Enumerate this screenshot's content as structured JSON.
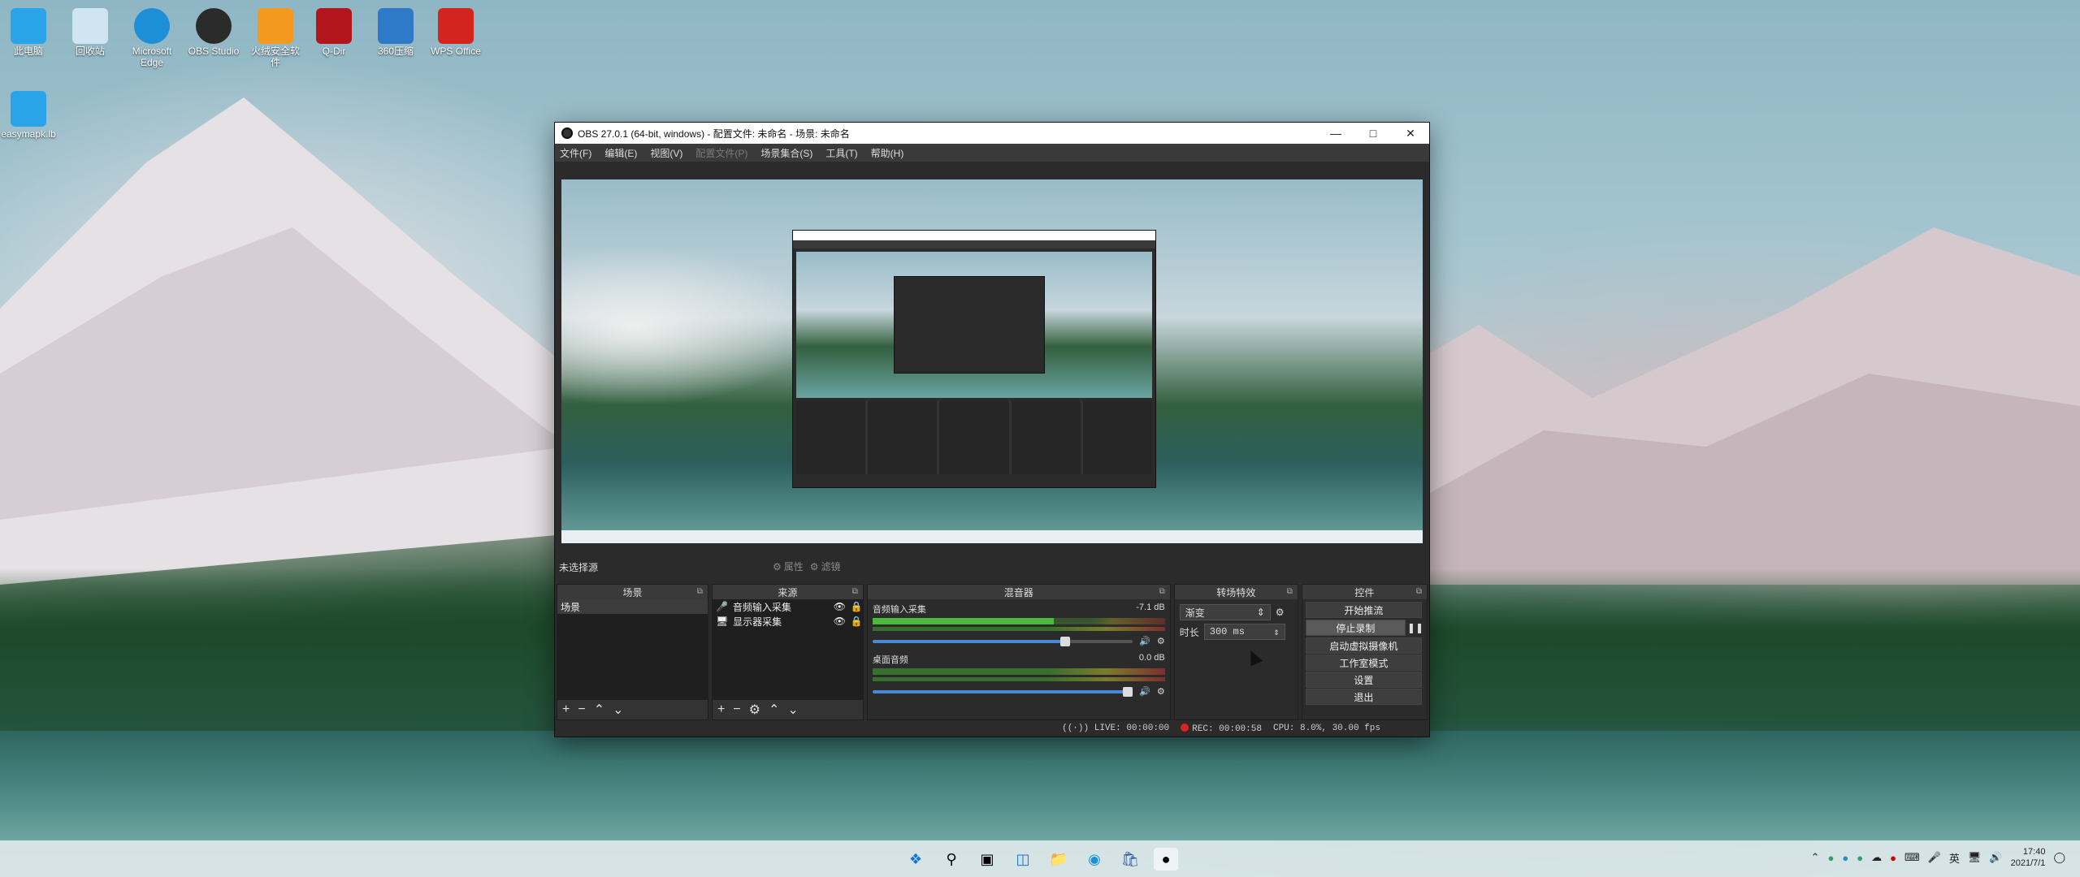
{
  "desktop": {
    "icons": [
      {
        "label": "此电脑",
        "icon": "computer-icon",
        "color": "#2aa3e8"
      },
      {
        "label": "回收站",
        "icon": "recycle-bin-icon",
        "color": "#cfe6f2"
      },
      {
        "label": "Microsoft Edge",
        "icon": "edge-icon",
        "color": "#1d8fd6"
      },
      {
        "label": "OBS Studio",
        "icon": "obs-icon",
        "color": "#2b2b2b"
      },
      {
        "label": "火绒安全软件",
        "icon": "huorong-icon",
        "color": "#f39a1e"
      },
      {
        "label": "Q-Dir",
        "icon": "qdir-icon",
        "color": "#b3151c"
      },
      {
        "label": "360压缩",
        "icon": "360zip-icon",
        "color": "#2f7ac8"
      },
      {
        "label": "WPS Office",
        "icon": "wps-icon",
        "color": "#d3251e"
      },
      {
        "label": "easymapk.lb",
        "icon": "monitor-icon",
        "color": "#2aa3e8"
      }
    ]
  },
  "obs": {
    "title": "OBS 27.0.1 (64-bit, windows) - 配置文件: 未命名 - 场景: 未命名",
    "menu": [
      {
        "label": "文件(F)",
        "disabled": false
      },
      {
        "label": "编辑(E)",
        "disabled": false
      },
      {
        "label": "视图(V)",
        "disabled": false
      },
      {
        "label": "配置文件(P)",
        "disabled": true
      },
      {
        "label": "场景集合(S)",
        "disabled": false
      },
      {
        "label": "工具(T)",
        "disabled": false
      },
      {
        "label": "帮助(H)",
        "disabled": false
      }
    ],
    "source_bar": {
      "no_source": "未选择源",
      "properties": "属性",
      "filters": "滤镜"
    },
    "scenes": {
      "header": "场景",
      "items": [
        "场景"
      ]
    },
    "sources": {
      "header": "来源",
      "items": [
        "音频输入采集",
        "显示器采集"
      ]
    },
    "mixer": {
      "header": "混音器",
      "channels": [
        {
          "name": "音频输入采集",
          "db": "-7.1 dB",
          "volume": 0.74
        },
        {
          "name": "桌面音频",
          "db": "0.0 dB",
          "volume": 0.98
        }
      ]
    },
    "transitions": {
      "header": "转场特效",
      "type": "渐变",
      "duration_label": "时长",
      "duration": "300 ms"
    },
    "controls": {
      "header": "控件",
      "buttons": [
        "开始推流",
        "停止录制",
        "启动虚拟摄像机",
        "工作室模式",
        "设置",
        "退出"
      ]
    },
    "status": {
      "live": "LIVE: 00:00:00",
      "rec": "REC: 00:00:58",
      "cpu": "CPU: 8.0%, 30.00 fps"
    }
  },
  "taskbar": {
    "ime": "英",
    "time": "17:40",
    "date": "2021/7/1"
  }
}
